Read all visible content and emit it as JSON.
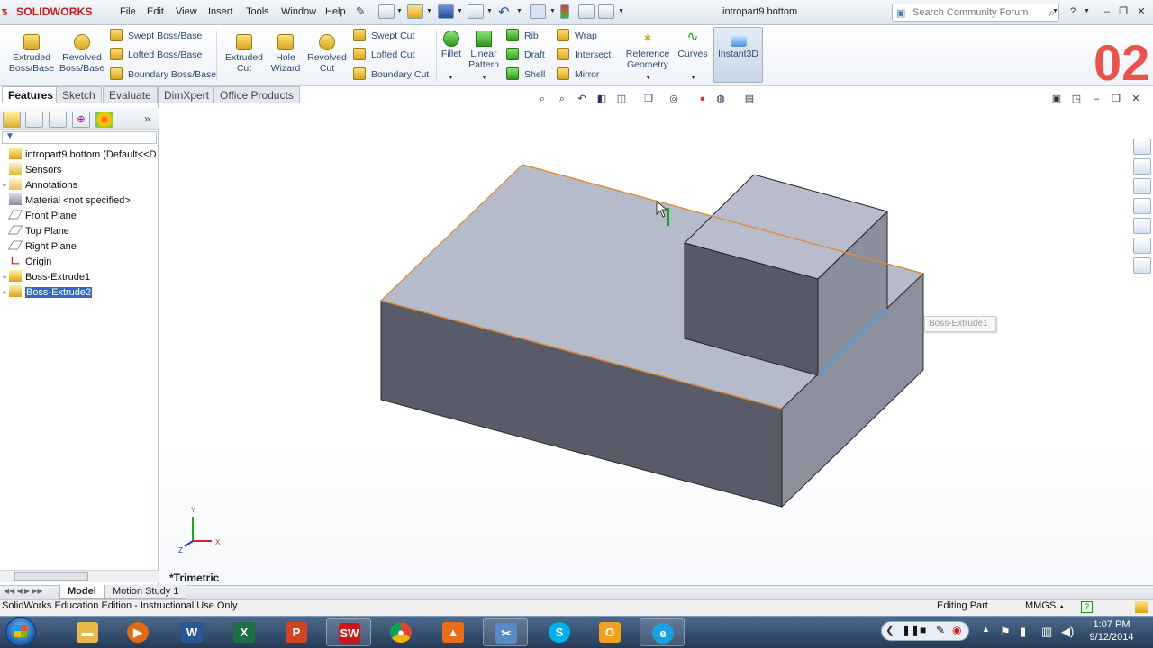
{
  "app": {
    "brand": "SOLIDWORKS",
    "menu": [
      "File",
      "Edit",
      "View",
      "Insert",
      "Tools",
      "Window",
      "Help"
    ],
    "doc_title": "intropart9 bottom",
    "search_placeholder": "Search Community Forum"
  },
  "command_manager": {
    "big_tools": [
      {
        "label": [
          "Extruded",
          "Boss/Base"
        ]
      },
      {
        "label": [
          "Revolved",
          "Boss/Base"
        ]
      },
      {
        "label": [
          "Extruded",
          "Cut"
        ]
      },
      {
        "label": [
          "Hole",
          "Wizard"
        ]
      },
      {
        "label": [
          "Revolved",
          "Cut"
        ]
      },
      {
        "label": [
          "Fillet"
        ]
      },
      {
        "label": [
          "Linear",
          "Pattern"
        ]
      },
      {
        "label": [
          "Reference",
          "Geometry"
        ]
      },
      {
        "label": [
          "Curves"
        ]
      },
      {
        "label": [
          "Instant3D"
        ]
      }
    ],
    "boss_list": [
      "Swept Boss/Base",
      "Lofted Boss/Base",
      "Boundary Boss/Base"
    ],
    "cut_list": [
      "Swept Cut",
      "Lofted Cut",
      "Boundary Cut"
    ],
    "feat_list": [
      "Rib",
      "Draft",
      "Shell"
    ],
    "feat_list2": [
      "Wrap",
      "Intersect",
      "Mirror"
    ]
  },
  "tabs": [
    "Features",
    "Sketch",
    "Evaluate",
    "DimXpert",
    "Office Products"
  ],
  "feature_tree": [
    {
      "label": "intropart9 bottom  (Default<<D",
      "expander": "",
      "icon": "part-icon"
    },
    {
      "label": "Sensors",
      "expander": "",
      "icon": "sensors-icon"
    },
    {
      "label": "Annotations",
      "expander": "+",
      "icon": "annotations-icon"
    },
    {
      "label": "Material <not specified>",
      "expander": "",
      "icon": "material-icon"
    },
    {
      "label": "Front Plane",
      "expander": "",
      "icon": "plane-icon"
    },
    {
      "label": "Top Plane",
      "expander": "",
      "icon": "plane-icon"
    },
    {
      "label": "Right Plane",
      "expander": "",
      "icon": "plane-icon"
    },
    {
      "label": "Origin",
      "expander": "",
      "icon": "origin-icon"
    },
    {
      "label": "Boss-Extrude1",
      "expander": "+",
      "icon": "extrude-icon"
    },
    {
      "label": "Boss-Extrude2",
      "expander": "+",
      "icon": "extrude-icon",
      "selected": true
    }
  ],
  "viewport": {
    "view_name": "*Trimetric",
    "tooltip": "Boss-Extrude1",
    "triad": {
      "x": "X",
      "y": "Y",
      "z": "Z"
    },
    "badge": "02"
  },
  "model_tabs": [
    "Model",
    "Motion Study 1"
  ],
  "status": {
    "left": "SolidWorks Education Edition - Instructional Use Only",
    "mode": "Editing Part",
    "units": "MMGS"
  },
  "taskbar": {
    "time": "1:07 PM",
    "date": "9/12/2014"
  }
}
